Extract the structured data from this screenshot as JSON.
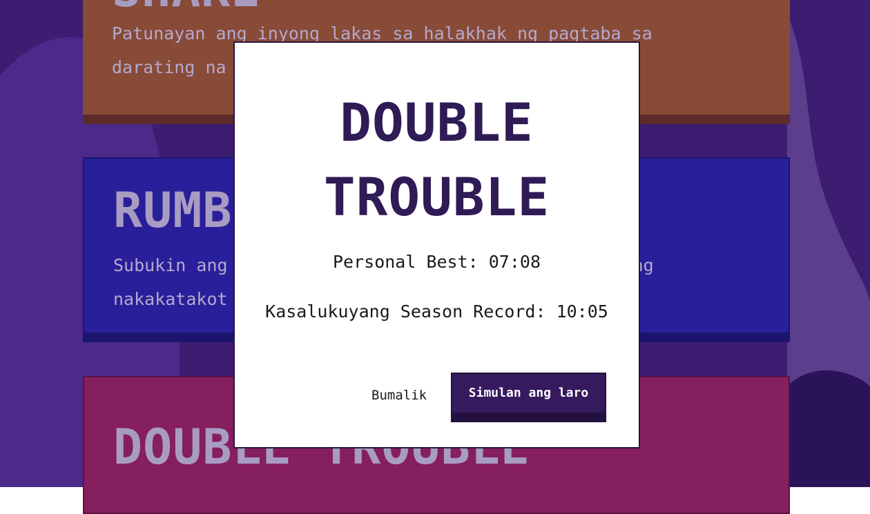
{
  "background_color": "#3d1d72",
  "cards": {
    "shake": {
      "title": "SHAKE",
      "description": "Patunayan ang inyong lakas sa halakhak ng pagtaba sa darating na malubhang pagyanig ng lupa!",
      "color": "#884b37"
    },
    "rumble": {
      "title": "RUMBLE",
      "description": "Subukin ang inyong katatagan at kaalaman sa gitna ng nakakatakot na nagngangalit na nagsasaalang bagyo!",
      "color": "#2a1f9a"
    },
    "double": {
      "title": "DOUBLE TROUBLE",
      "color": "#851f5d"
    }
  },
  "modal": {
    "title": "DOUBLE TROUBLE",
    "personal_best_label": "Personal Best: 07:08",
    "season_record_label": "Kasalukuyang Season Record: 10:05",
    "back_button_label": "Bumalik",
    "start_button_label": "Simulan ang laro",
    "accent_color": "#351a5e"
  }
}
